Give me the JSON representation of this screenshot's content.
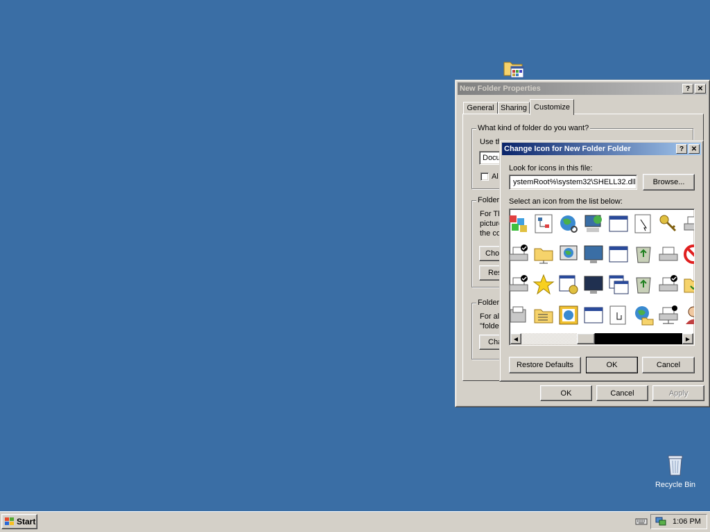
{
  "desktop": {
    "folder_icon": "folder-icon",
    "recycle_bin": {
      "label": "Recycle Bin",
      "icon": "recycle-bin-icon"
    }
  },
  "props_window": {
    "title": "New Folder Properties",
    "help_btn": "?",
    "close_btn": "✕",
    "tabs": [
      "General",
      "Sharing",
      "Customize"
    ],
    "active_tab": "Customize",
    "group1": {
      "label": "What kind of folder do you want?",
      "use_text": "Use th",
      "select_value": "Docu",
      "also_text": "Al"
    },
    "group2": {
      "label": "Folder",
      "lines": [
        "For Th",
        "picture",
        "the co"
      ],
      "choose_btn": "Choo",
      "restore_btn": "Res"
    },
    "group3": {
      "label": "Folder",
      "lines": [
        "For all",
        "\"folde"
      ],
      "change_btn": "Cha"
    },
    "ok": "OK",
    "cancel": "Cancel",
    "apply": "Apply"
  },
  "change_icon_dialog": {
    "title": "Change Icon for New Folder Folder",
    "help_btn": "?",
    "close_btn": "✕",
    "look_label": "Look for icons in this file:",
    "file_path": "ystemRoot%\\system32\\SHELL32.dll",
    "browse": "Browse...",
    "select_label": "Select an icon from the list below:",
    "icons": [
      [
        "apps-icon",
        "network-tree-icon",
        "globe-search-icon",
        "network-pc-icon",
        "window-icon",
        "cursor-icon",
        "keys-icon",
        "printer-icon"
      ],
      [
        "printer-check-icon",
        "folder-net-icon",
        "monitor-globe-icon",
        "monitor-icon",
        "window-icon",
        "recycle-full-icon",
        "printer-icon",
        "no-icon"
      ],
      [
        "printer-check-icon",
        "star-icon",
        "settings-window-icon",
        "monitor-dark-icon",
        "windows-icon",
        "recycle-full-icon",
        "printer-check-icon",
        "folder-check-icon"
      ],
      [
        "fax-icon",
        "folder-list-icon",
        "globe-frame-icon",
        "window-icon",
        "hand-pointer-icon",
        "globe-folder-icon",
        "printer-net-icon",
        "user-icon"
      ]
    ],
    "restore_defaults": "Restore Defaults",
    "ok": "OK",
    "cancel": "Cancel"
  },
  "taskbar": {
    "start": "Start",
    "time": "1:06 PM",
    "tray_icons": [
      "keyboard-icon",
      "network-icon"
    ]
  },
  "colors": {
    "desktop": "#3a6ea5",
    "title_active": "#0a246a",
    "title_inactive": "#808080",
    "face": "#d4d0c8"
  }
}
